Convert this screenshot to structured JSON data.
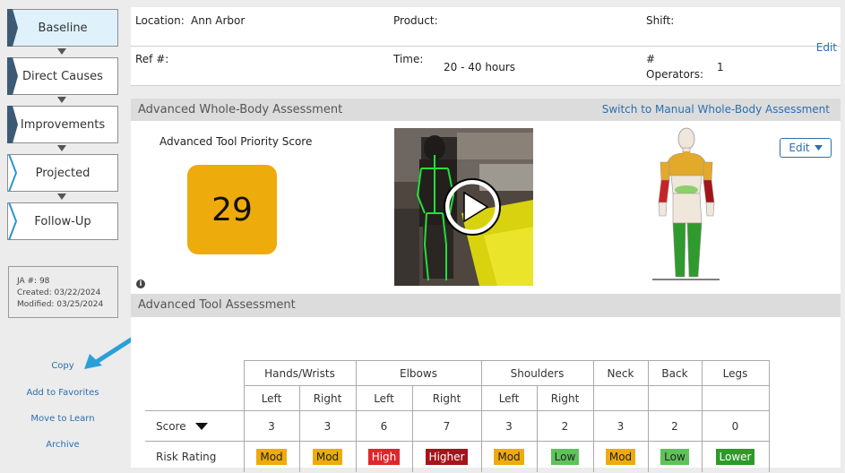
{
  "sidebar": {
    "steps": [
      "Baseline",
      "Direct Causes",
      "Improvements",
      "Projected",
      "Follow-Up"
    ],
    "meta": {
      "ja": "JA #: 98",
      "created": "Created: 03/22/2024",
      "modified": "Modified: 03/25/2024"
    },
    "links": [
      "Copy",
      "Add to Favorites",
      "Move to Learn",
      "Archive"
    ]
  },
  "info": {
    "location_label": "Location:",
    "location_value": "Ann Arbor",
    "product_label": "Product:",
    "shift_label": "Shift:",
    "ref_label": "Ref #:",
    "time_label": "Time:",
    "time_value": "20 - 40 hours",
    "operators_label_1": "#",
    "operators_label_2": "Operators:",
    "operators_value": "1",
    "edit": "Edit"
  },
  "whole_body": {
    "header": "Advanced Whole-Body Assessment",
    "switch_link": "Switch to Manual Whole-Body Assessment",
    "score_title": "Advanced Tool Priority Score",
    "score": "29",
    "score_color": "#edac0c",
    "edit_button": "Edit",
    "info_icon": "i"
  },
  "tool_assessment": {
    "header": "Advanced Tool Assessment",
    "groups": [
      "Hands/Wrists",
      "Elbows",
      "Shoulders",
      "Neck",
      "Back",
      "Legs"
    ],
    "sides": [
      "Left",
      "Right",
      "Left",
      "Right",
      "Left",
      "Right"
    ],
    "score_label": "Score",
    "risk_label": "Risk Rating",
    "scores": [
      "3",
      "3",
      "6",
      "7",
      "3",
      "2",
      "3",
      "2",
      "0"
    ],
    "ratings": [
      {
        "text": "Mod",
        "color": "#edac0c",
        "fg": "#222"
      },
      {
        "text": "Mod",
        "color": "#edac0c",
        "fg": "#222"
      },
      {
        "text": "High",
        "color": "#e0262c",
        "fg": "#fff"
      },
      {
        "text": "Higher",
        "color": "#a5141b",
        "fg": "#fff"
      },
      {
        "text": "Mod",
        "color": "#edac0c",
        "fg": "#222"
      },
      {
        "text": "Low",
        "color": "#5fc25b",
        "fg": "#222"
      },
      {
        "text": "Mod",
        "color": "#edac0c",
        "fg": "#222"
      },
      {
        "text": "Low",
        "color": "#5fc25b",
        "fg": "#222"
      },
      {
        "text": "Lower",
        "color": "#2d9a2a",
        "fg": "#fff"
      }
    ]
  }
}
